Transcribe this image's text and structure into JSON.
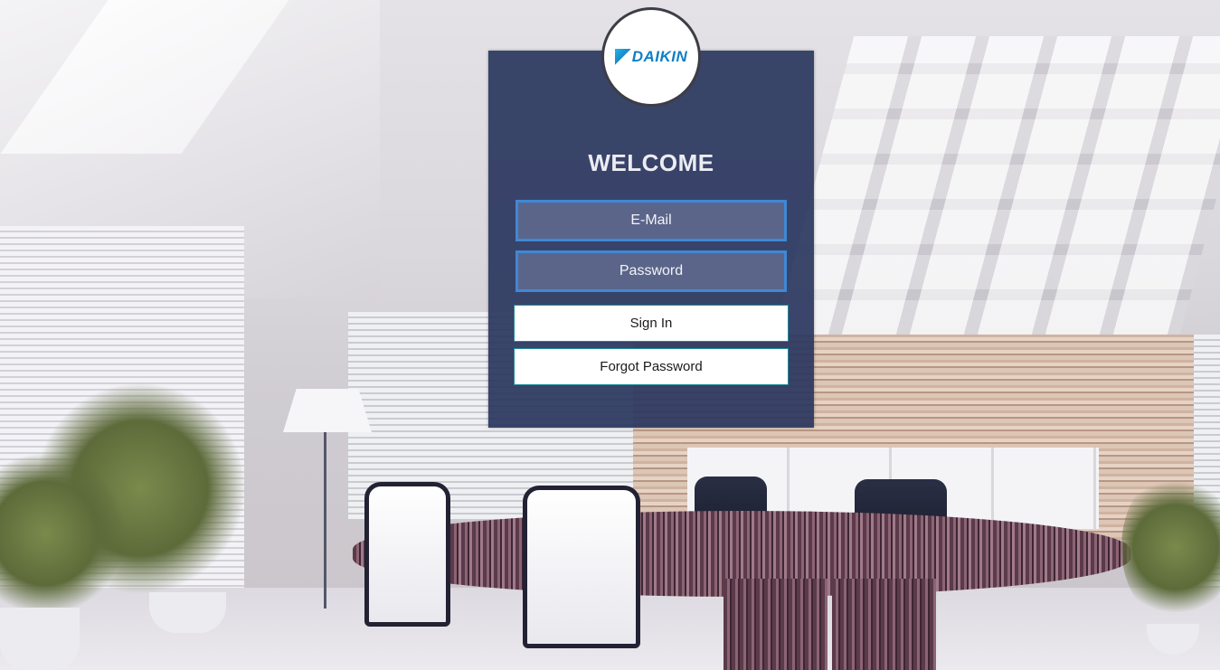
{
  "brand": {
    "logo_text": "DAIKIN",
    "logo_color": "#0f7fc6"
  },
  "login": {
    "heading": "WELCOME",
    "email_placeholder": "E-Mail",
    "password_placeholder": "Password",
    "sign_in_label": "Sign In",
    "forgot_password_label": "Forgot Password"
  },
  "colors": {
    "card_background": "#2a365e",
    "field_border": "#3f88d6",
    "button_border": "#1e8a9a"
  }
}
